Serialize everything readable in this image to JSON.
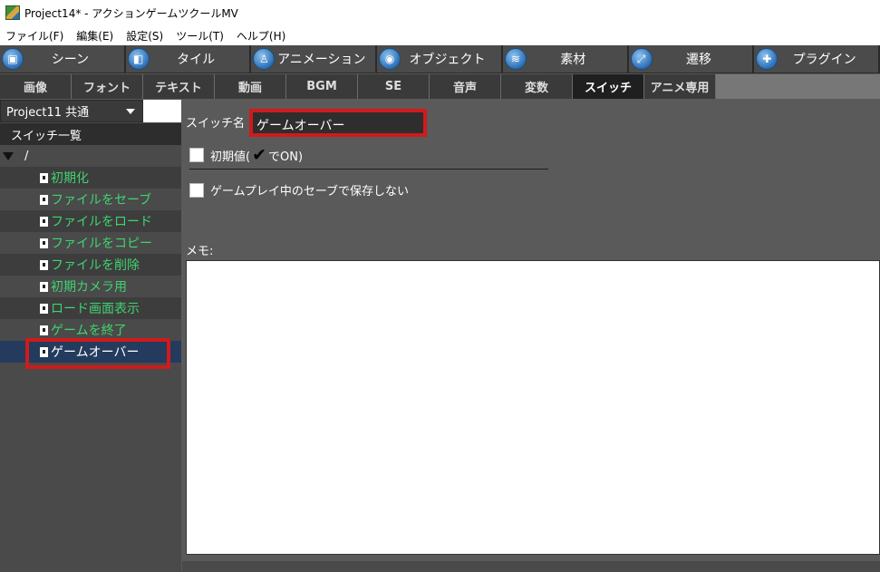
{
  "window": {
    "title": "Project14* - アクションゲームツクールMV"
  },
  "menu": [
    "ファイル(F)",
    "編集(E)",
    "設定(S)",
    "ツール(T)",
    "ヘルプ(H)"
  ],
  "toolbar": [
    {
      "label": "シーン",
      "icon": "scene-icon"
    },
    {
      "label": "タイル",
      "icon": "tile-icon"
    },
    {
      "label": "アニメーション",
      "icon": "animation-icon"
    },
    {
      "label": "オブジェクト",
      "icon": "object-icon"
    },
    {
      "label": "素材",
      "icon": "resource-icon"
    },
    {
      "label": "遷移",
      "icon": "transition-icon"
    },
    {
      "label": "プラグイン",
      "icon": "plugin-icon"
    }
  ],
  "tabs": [
    "画像",
    "フォント",
    "テキスト",
    "動画",
    "BGM",
    "SE",
    "音声",
    "変数",
    "スイッチ",
    "アニメ専用"
  ],
  "active_tab": "スイッチ",
  "left": {
    "project": "Project11 共通",
    "list_header": "スイッチ一覧",
    "root": "/",
    "switches": [
      "初期化",
      "ファイルをセーブ",
      "ファイルをロード",
      "ファイルをコピー",
      "ファイルを削除",
      "初期カメラ用",
      "ロード画面表示",
      "ゲームを終了",
      "ゲームオーバー"
    ],
    "selected": "ゲームオーバー"
  },
  "detail": {
    "name_label": "スイッチ名",
    "name_value": "ゲームオーバー",
    "initial_prefix": "初期値(",
    "initial_check": "✔",
    "initial_suffix": "でON)",
    "nosave_label": "ゲームプレイ中のセーブで保存しない",
    "memo_label": "メモ:"
  },
  "colors": {
    "switch_text": "#3fd46f",
    "highlight": "#d11a1a",
    "selected_row": "#243b5e"
  }
}
